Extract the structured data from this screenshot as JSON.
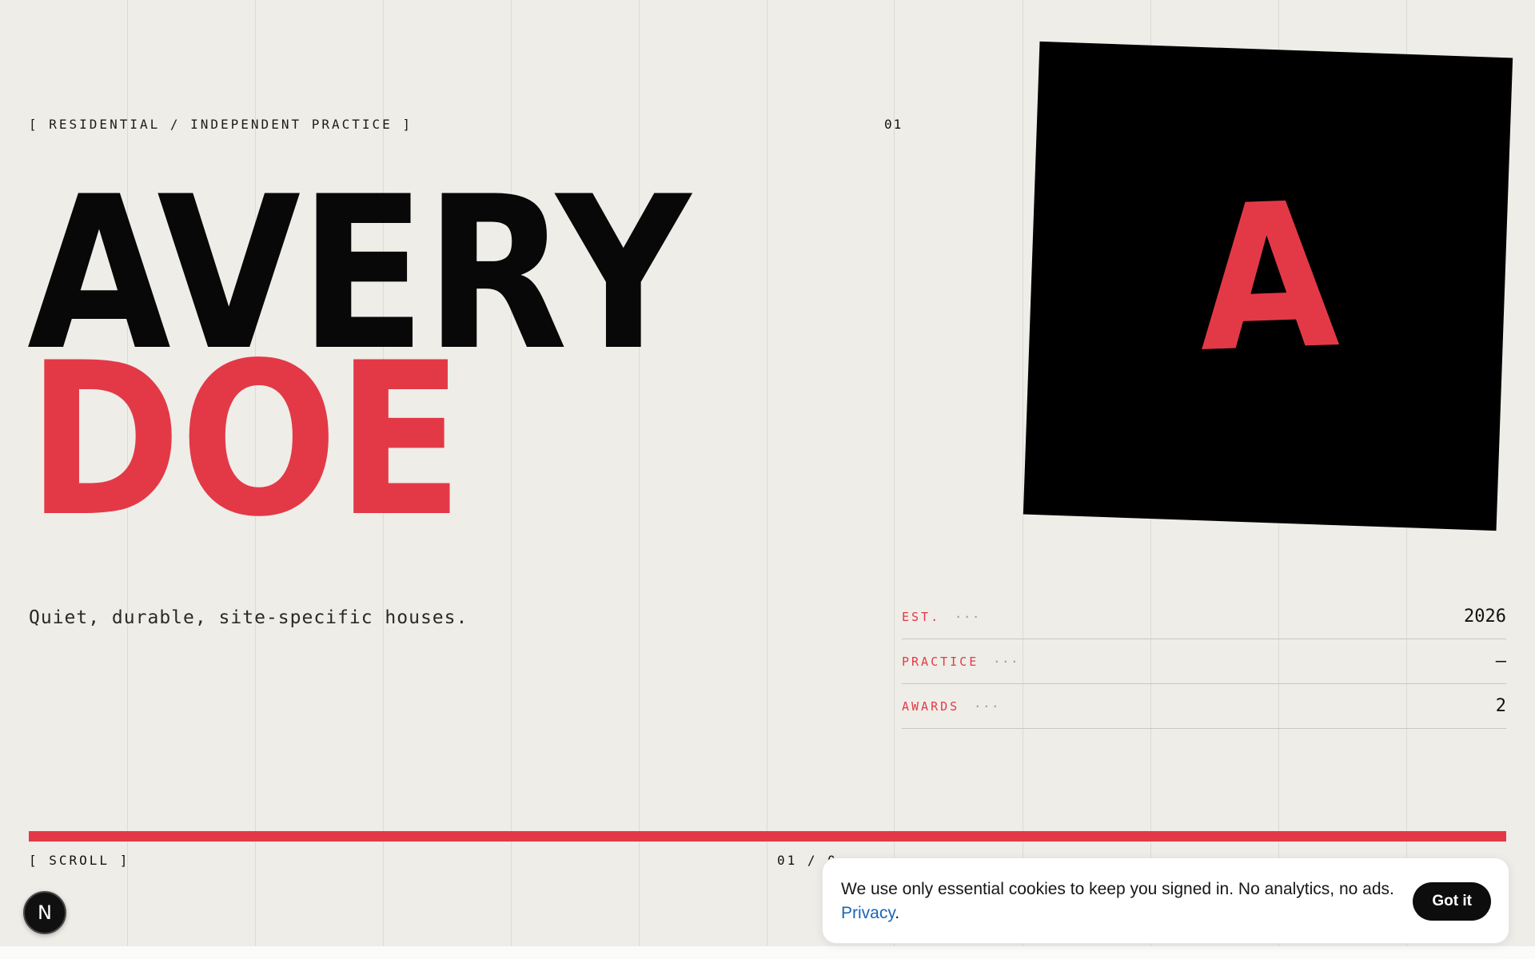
{
  "hero": {
    "eyebrow": "[ RESIDENTIAL / INDEPENDENT PRACTICE ]",
    "index": "01",
    "first_name": "AVERY",
    "last_name": "DOE",
    "tagline": "Quiet, durable, site-specific houses.",
    "monogram": "A"
  },
  "facts": [
    {
      "label": "EST.",
      "dots": "···",
      "value": "2026"
    },
    {
      "label": "PRACTICE",
      "dots": "···",
      "value": "—"
    },
    {
      "label": "AWARDS",
      "dots": "···",
      "value": "2"
    }
  ],
  "footer": {
    "scroll_label": "[ SCROLL ]",
    "page_counter": "01 / 0",
    "scroll_progress_percent": 100
  },
  "badge": {
    "letter": "N"
  },
  "cookie": {
    "message": "We use only essential cookies to keep you signed in. No analytics, no ads.",
    "link_label": "Privacy",
    "link_suffix": ".",
    "button_label": "Got it"
  },
  "colors": {
    "background": "#efede8",
    "accent": "#e33947",
    "ink": "#080808",
    "link": "#1a66b5"
  }
}
